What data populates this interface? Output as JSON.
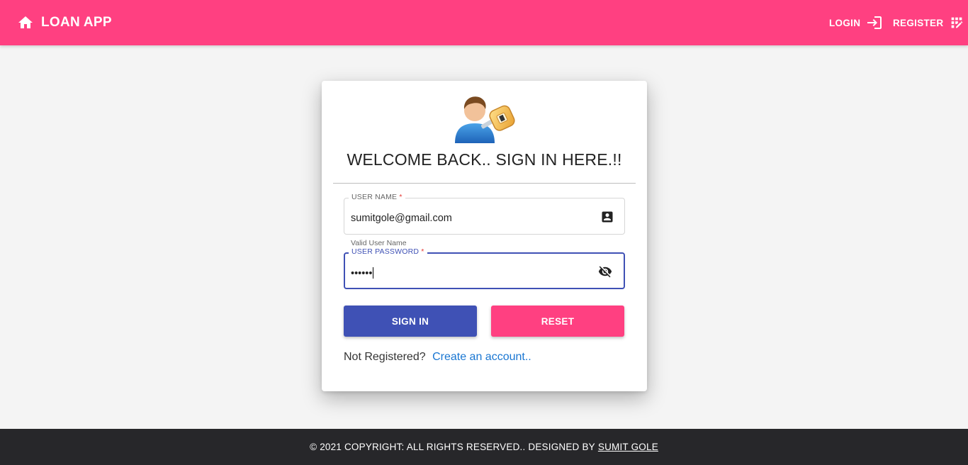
{
  "header": {
    "brand_icon": "home-icon",
    "brand_title": "LOAN APP",
    "login_label": "LOGIN",
    "login_icon": "login-icon",
    "register_label": "REGISTER",
    "register_icon": "app-registration-icon"
  },
  "login_card": {
    "avatar_icon": "user-key-icon",
    "heading": "WELCOME BACK.. SIGN IN HERE.!!",
    "username": {
      "label": "USER NAME",
      "required_mark": "*",
      "value": "sumitgole@gmail.com",
      "icon": "contact-card-icon",
      "hint": "Valid User Name"
    },
    "password": {
      "label": "USER PASSWORD",
      "required_mark": "*",
      "value": "••••••",
      "icon": "visibility-off-icon"
    },
    "signin_label": "SIGN IN",
    "reset_label": "RESET",
    "not_registered_text": "Not Registered?",
    "create_account_link": "Create an account.."
  },
  "footer": {
    "copyright_text": "© 2021 COPYRIGHT: ALL RIGHTS RESERVED.. DESIGNED BY",
    "author_link": "SUMIT GOLE"
  },
  "colors": {
    "primary_pink": "#ff4081",
    "indigo": "#3f51b5",
    "link_blue": "#1976d2",
    "footer_dark": "#27272a",
    "background": "#f4f4f4"
  }
}
